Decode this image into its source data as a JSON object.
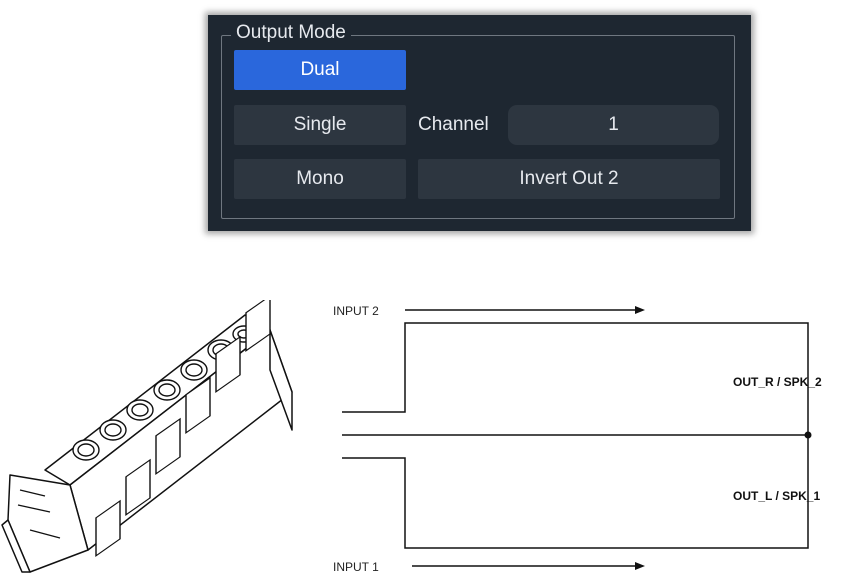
{
  "panel": {
    "group_title": "Output Mode",
    "modes": [
      {
        "label": "Dual",
        "active": true
      },
      {
        "label": "Single",
        "active": false
      },
      {
        "label": "Mono",
        "active": false
      }
    ],
    "channel_label": "Channel",
    "channel_value": "1",
    "invert_label": "Invert Out 2",
    "colors": {
      "panel_bg": "#1e2731",
      "button_bg": "#2d3640",
      "active_bg": "#2a67dc",
      "text": "#e6e9ee"
    }
  },
  "diagram": {
    "input_top": "INPUT 2",
    "input_bottom": "INPUT 1",
    "out_top": "OUT_R / SPK_2",
    "out_bottom": "OUT_L / SPK_1"
  }
}
